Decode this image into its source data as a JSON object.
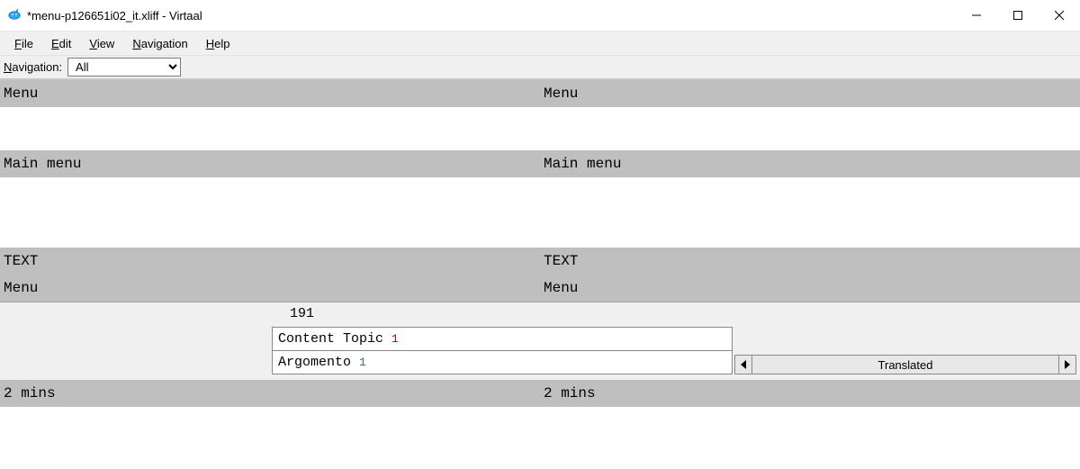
{
  "window": {
    "title": "*menu-p126651i02_it.xliff - Virtaal"
  },
  "menubar": {
    "file": {
      "u": "F",
      "rest": "ile"
    },
    "edit": {
      "u": "E",
      "rest": "dit"
    },
    "view": {
      "u": "V",
      "rest": "iew"
    },
    "navigation": {
      "u": "N",
      "rest": "avigation"
    },
    "help": {
      "u": "H",
      "rest": "elp"
    }
  },
  "navigation": {
    "label_u": "N",
    "label_rest": "avigation:",
    "selected": "All"
  },
  "rows": [
    {
      "bg": "grey",
      "h": "thin",
      "src": "Menu",
      "tgt": "Menu"
    },
    {
      "bg": "white",
      "h": "tall",
      "src": "",
      "tgt": ""
    },
    {
      "bg": "grey",
      "h": "thin",
      "src": "Main menu",
      "tgt": "Main menu"
    },
    {
      "bg": "white",
      "h": "thin",
      "src": "",
      "tgt": ""
    },
    {
      "bg": "white",
      "h": "tall",
      "src": "",
      "tgt": ""
    },
    {
      "bg": "grey",
      "h": "thin",
      "src": "TEXT",
      "tgt": "TEXT"
    },
    {
      "bg": "grey",
      "h": "thin",
      "src": "Menu",
      "tgt": "Menu"
    }
  ],
  "active": {
    "unit_id": "191",
    "source_prefix": "Content Topic ",
    "source_hl": "1",
    "target_prefix": "Argomento ",
    "target_hl": "1",
    "status": "Translated"
  },
  "bottom": {
    "src": "2 mins",
    "tgt": "2 mins"
  }
}
